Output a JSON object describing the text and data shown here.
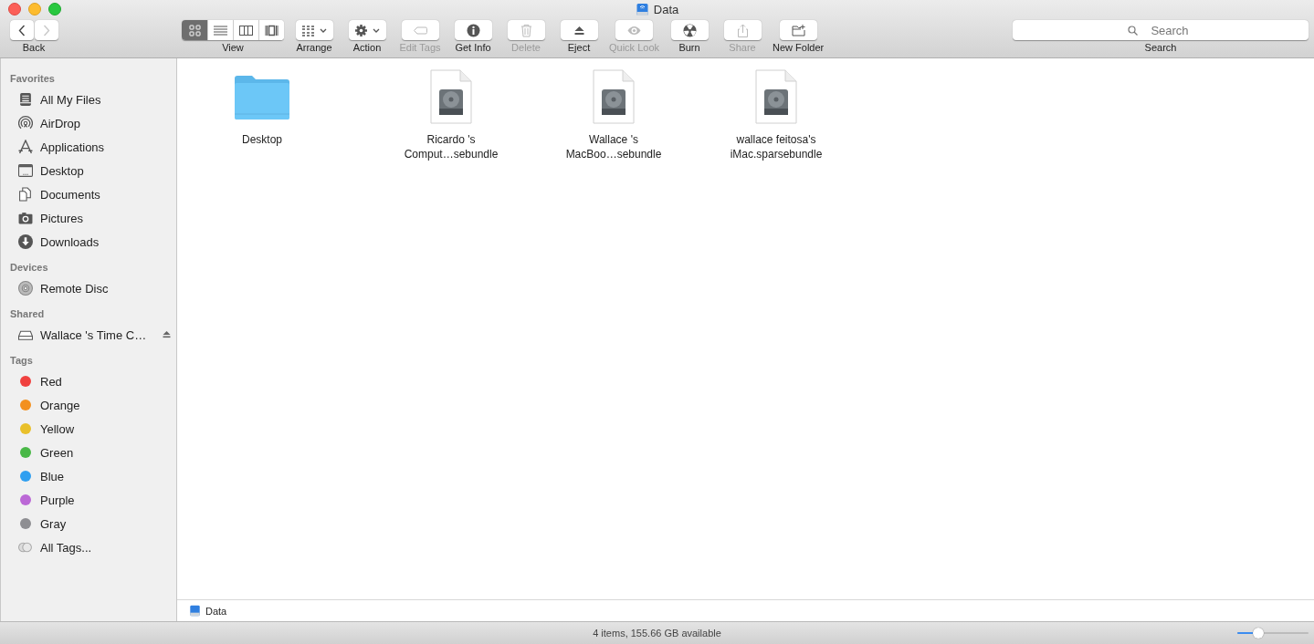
{
  "window": {
    "title": "Data"
  },
  "toolbar": {
    "nav": {
      "label": "Back",
      "back_disabled": false,
      "forward_disabled": true
    },
    "view": {
      "label": "View",
      "modes": [
        {
          "kind": "icons",
          "selected": true
        },
        {
          "kind": "list",
          "selected": false
        },
        {
          "kind": "columns",
          "selected": false
        },
        {
          "kind": "coverflow",
          "selected": false
        }
      ]
    },
    "tools": [
      {
        "kind": "arrange",
        "label": "Arrange",
        "disabled": false
      },
      {
        "kind": "action",
        "label": "Action",
        "disabled": false
      },
      {
        "kind": "tags",
        "label": "Edit Tags",
        "disabled": true
      },
      {
        "kind": "info",
        "label": "Get Info",
        "disabled": false
      },
      {
        "kind": "delete",
        "label": "Delete",
        "disabled": true
      },
      {
        "kind": "eject",
        "label": "Eject",
        "disabled": false
      },
      {
        "kind": "quicklook",
        "label": "Quick Look",
        "disabled": true
      },
      {
        "kind": "burn",
        "label": "Burn",
        "disabled": false
      },
      {
        "kind": "share",
        "label": "Share",
        "disabled": true
      },
      {
        "kind": "newfolder",
        "label": "New Folder",
        "disabled": false
      }
    ],
    "search": {
      "placeholder": "Search",
      "label": "Search"
    }
  },
  "sidebar": {
    "sections": [
      {
        "heading": "Favorites",
        "items": [
          {
            "kind": "allfiles",
            "label": "All My Files"
          },
          {
            "kind": "airdrop",
            "label": "AirDrop"
          },
          {
            "kind": "apps",
            "label": "Applications"
          },
          {
            "kind": "desktop",
            "label": "Desktop"
          },
          {
            "kind": "documents",
            "label": "Documents"
          },
          {
            "kind": "pictures",
            "label": "Pictures"
          },
          {
            "kind": "downloads",
            "label": "Downloads"
          }
        ]
      },
      {
        "heading": "Devices",
        "items": [
          {
            "kind": "disc",
            "label": "Remote Disc"
          }
        ]
      },
      {
        "heading": "Shared",
        "items": [
          {
            "kind": "server",
            "label": "Wallace 's Time C…",
            "eject": true
          }
        ]
      },
      {
        "heading": "Tags",
        "items": [
          {
            "kind": "tag",
            "label": "Red",
            "color": "#f0413f"
          },
          {
            "kind": "tag",
            "label": "Orange",
            "color": "#f3901f"
          },
          {
            "kind": "tag",
            "label": "Yellow",
            "color": "#e9c02a"
          },
          {
            "kind": "tag",
            "label": "Green",
            "color": "#49b847"
          },
          {
            "kind": "tag",
            "label": "Blue",
            "color": "#2f9ff0"
          },
          {
            "kind": "tag",
            "label": "Purple",
            "color": "#bb68d6"
          },
          {
            "kind": "tag",
            "label": "Gray",
            "color": "#8e8e92"
          },
          {
            "kind": "alltags",
            "label": "All Tags..."
          }
        ]
      }
    ]
  },
  "files": [
    {
      "kind": "folder",
      "name": "Desktop"
    },
    {
      "kind": "bundle",
      "name": "Ricardo 's Comput…sebundle"
    },
    {
      "kind": "bundle",
      "name": "Wallace 's MacBoo…sebundle"
    },
    {
      "kind": "bundle",
      "name": "wallace feitosa's iMac.sparsebundle"
    }
  ],
  "path_bar": {
    "label": "Data"
  },
  "status_bar": {
    "text": "4 items, 155.66 GB available",
    "zoom": {
      "level": 0.3
    }
  }
}
